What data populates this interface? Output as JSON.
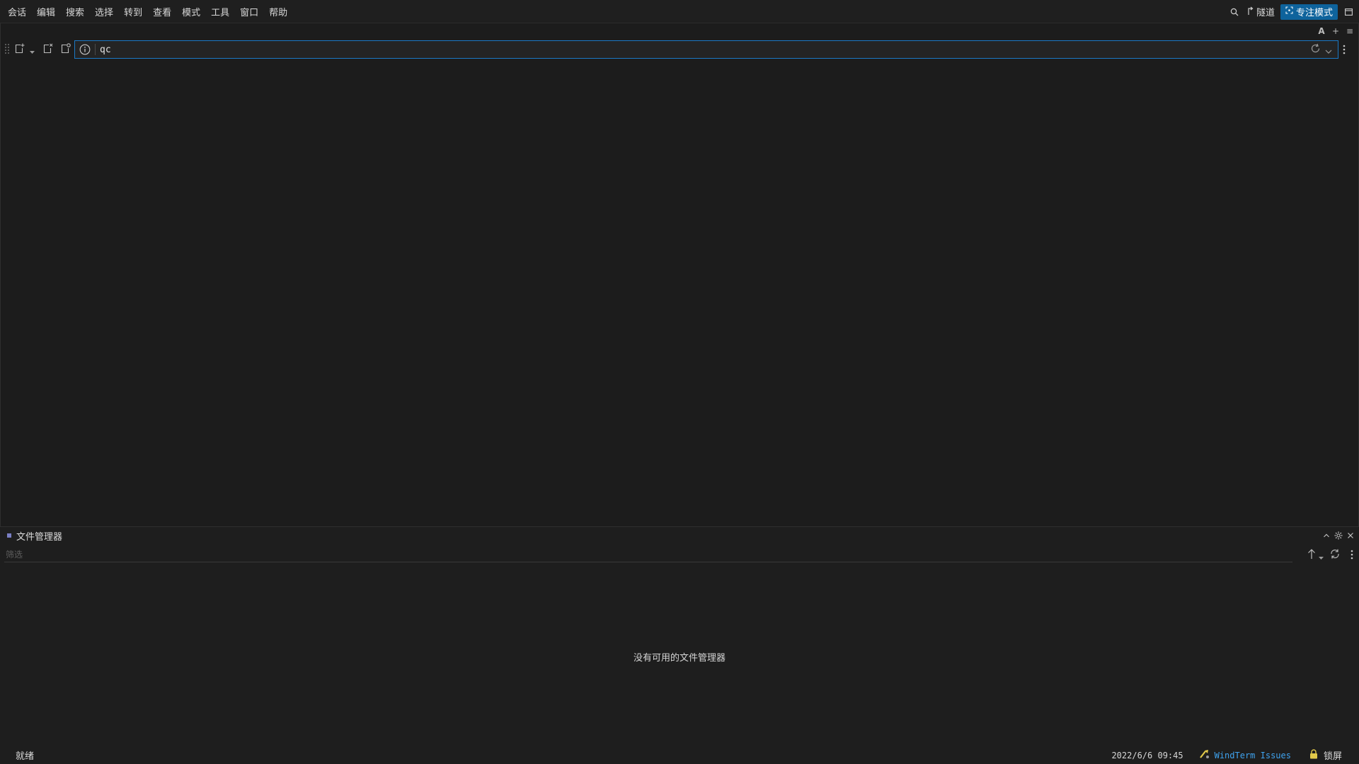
{
  "menubar": {
    "items": [
      "会话",
      "编辑",
      "搜索",
      "选择",
      "转到",
      "查看",
      "模式",
      "工具",
      "窗口",
      "帮助"
    ],
    "tunnel_label": "隧道",
    "focus_mode_label": "专注模式"
  },
  "terminal": {
    "tab_tools": {
      "font_label": "A",
      "add_label": "+",
      "list_label": "≡"
    },
    "address": {
      "value": "qc"
    }
  },
  "file_manager": {
    "title": "文件管理器",
    "filter_placeholder": "筛选",
    "empty_message": "没有可用的文件管理器"
  },
  "statusbar": {
    "status": "就绪",
    "datetime": "2022/6/6 09:45",
    "issues_label": "WindTerm Issues",
    "lock_label": "锁屏"
  },
  "colors": {
    "accent": "#0e639c",
    "focus_border": "#1b79c5",
    "link": "#3fa3ef",
    "background": "#1e1e1e"
  }
}
